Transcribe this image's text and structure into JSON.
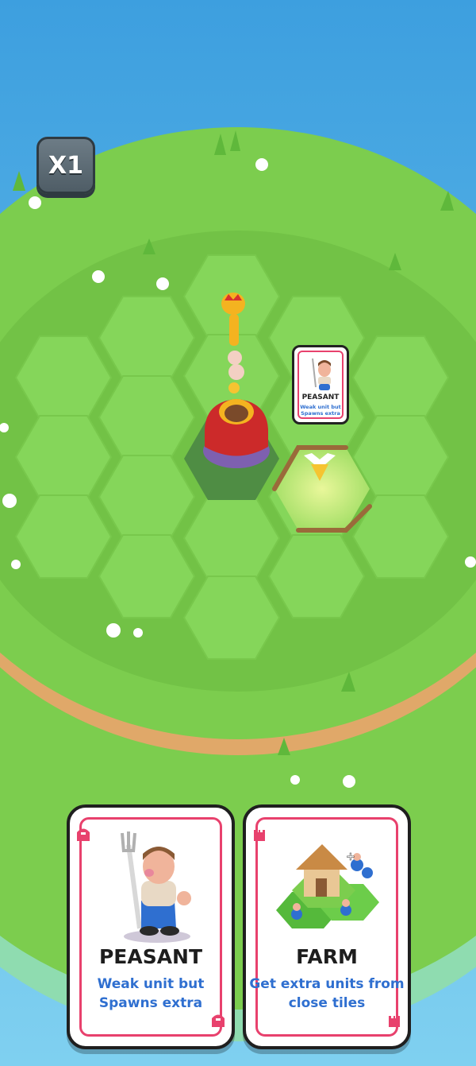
{
  "hud": {
    "speed_label": "X1"
  },
  "map_card": {
    "title": "PEASANT",
    "description": "Weak unit but Spawns extra"
  },
  "hand": [
    {
      "title": "PEASANT",
      "description": "Weak unit but Spawns extra",
      "icon": "knight-helmet-icon"
    },
    {
      "title": "FARM",
      "description": "Get extra units from close tiles",
      "icon": "castle-tower-icon"
    }
  ],
  "colors": {
    "accent_red": "#e8416d",
    "text_blue": "#2f6fd0",
    "grass": "#7ccd4e",
    "sea": "#4aa8e0"
  }
}
